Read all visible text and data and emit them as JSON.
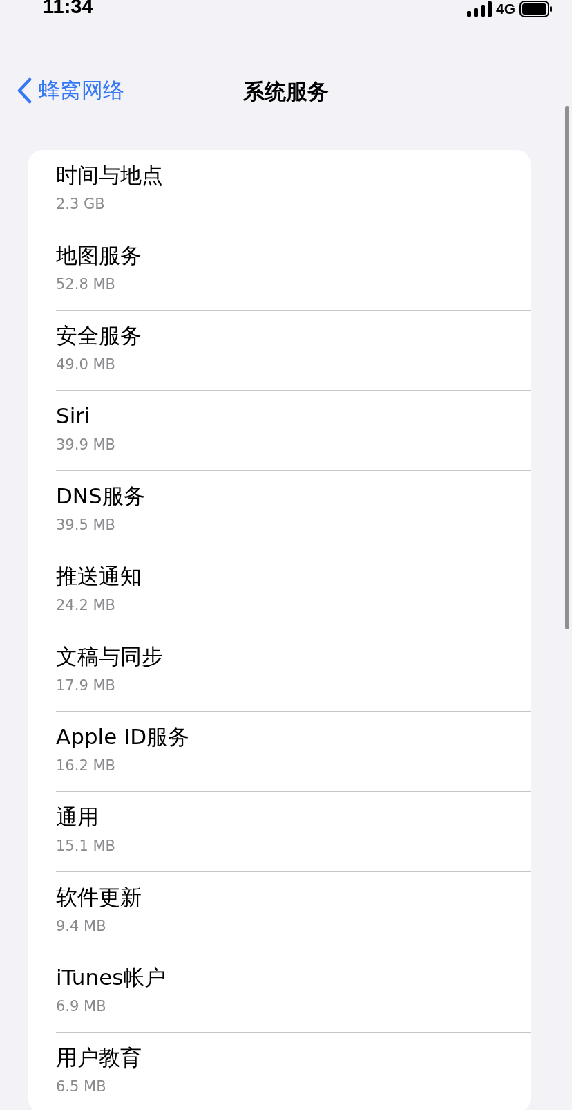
{
  "status_bar": {
    "time": "11:34",
    "network": "4G"
  },
  "nav": {
    "back": "蜂窝网络",
    "title": "系统服务"
  },
  "services": [
    {
      "name": "时间与地点",
      "usage": "2.3 GB"
    },
    {
      "name": "地图服务",
      "usage": "52.8 MB"
    },
    {
      "name": "安全服务",
      "usage": "49.0 MB"
    },
    {
      "name": "Siri",
      "usage": "39.9 MB"
    },
    {
      "name": "DNS服务",
      "usage": "39.5 MB"
    },
    {
      "name": "推送通知",
      "usage": "24.2 MB"
    },
    {
      "name": "文稿与同步",
      "usage": "17.9 MB"
    },
    {
      "name": "Apple ID服务",
      "usage": "16.2 MB"
    },
    {
      "name": "通用",
      "usage": "15.1 MB"
    },
    {
      "name": "软件更新",
      "usage": "9.4 MB"
    },
    {
      "name": "iTunes帐户",
      "usage": "6.9 MB"
    },
    {
      "name": "用户教育",
      "usage": "6.5 MB"
    }
  ]
}
